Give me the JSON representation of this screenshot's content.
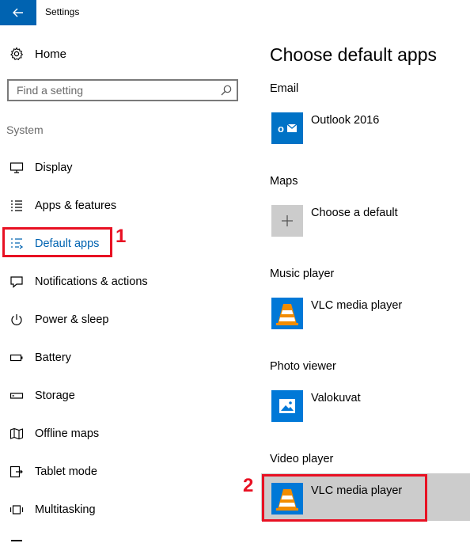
{
  "window": {
    "title": "Settings"
  },
  "home": {
    "label": "Home"
  },
  "search": {
    "placeholder": "Find a setting"
  },
  "section": {
    "label": "System"
  },
  "nav": {
    "items": [
      {
        "label": "Display",
        "icon": "display-icon"
      },
      {
        "label": "Apps & features",
        "icon": "list-icon"
      },
      {
        "label": "Default apps",
        "icon": "default-apps-icon",
        "selected": true
      },
      {
        "label": "Notifications & actions",
        "icon": "notification-icon"
      },
      {
        "label": "Power & sleep",
        "icon": "power-icon"
      },
      {
        "label": "Battery",
        "icon": "battery-icon"
      },
      {
        "label": "Storage",
        "icon": "storage-icon"
      },
      {
        "label": "Offline maps",
        "icon": "map-icon"
      },
      {
        "label": "Tablet mode",
        "icon": "tablet-icon"
      },
      {
        "label": "Multitasking",
        "icon": "multitasking-icon"
      }
    ]
  },
  "annotations": {
    "marker1": "1",
    "marker2": "2"
  },
  "main": {
    "title": "Choose default apps",
    "categories": [
      {
        "label": "Email",
        "app": "Outlook 2016",
        "icon": "outlook-icon"
      },
      {
        "label": "Maps",
        "app": "Choose a default",
        "icon": "plus-icon"
      },
      {
        "label": "Music player",
        "app": "VLC media player",
        "icon": "vlc-icon"
      },
      {
        "label": "Photo viewer",
        "app": "Valokuvat",
        "icon": "photos-icon"
      },
      {
        "label": "Video player",
        "app": "VLC media player",
        "icon": "vlc-icon"
      }
    ]
  },
  "colors": {
    "accent": "#0063b1",
    "highlight": "#e81123",
    "selected_bg": "#cccccc"
  }
}
